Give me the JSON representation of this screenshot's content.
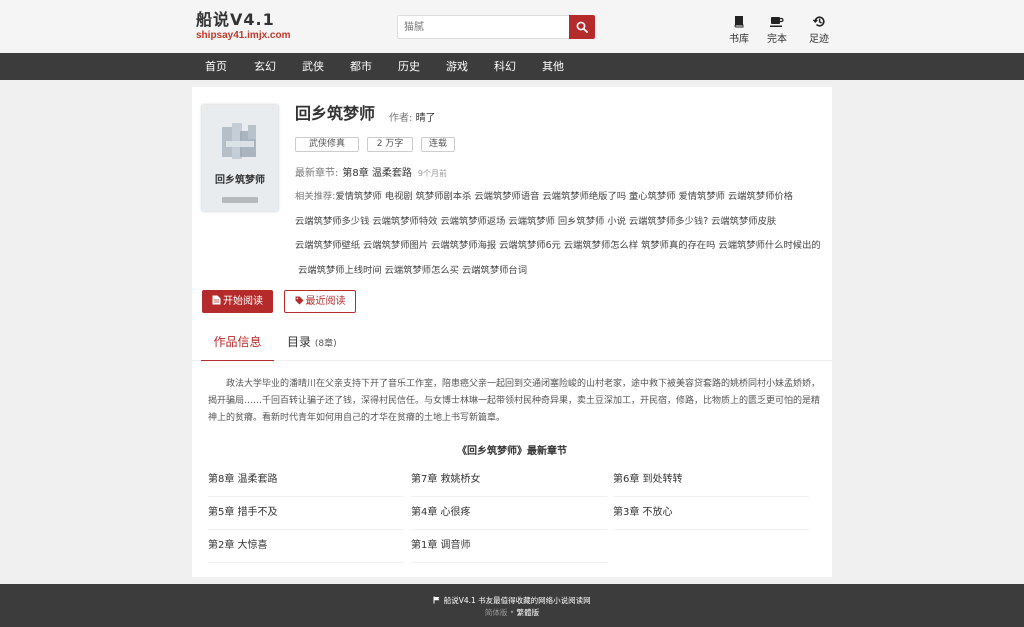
{
  "site": {
    "name": "船说V4.1",
    "domain": "shipsay41.imjx.com"
  },
  "search": {
    "placeholder": "猫腻"
  },
  "top_links": [
    {
      "label": "书库",
      "icon": "book-icon"
    },
    {
      "label": "完本",
      "icon": "coffee-icon"
    },
    {
      "label": "足迹",
      "icon": "history-icon"
    }
  ],
  "nav": [
    "首页",
    "玄幻",
    "武侠",
    "都市",
    "历史",
    "游戏",
    "科幻",
    "其他"
  ],
  "book": {
    "title": "回乡筑梦师",
    "cover_title": "回乡筑梦师",
    "author_label": "作者:",
    "author": "晴了",
    "tags": [
      "武侠修真",
      "2 万字",
      "连载"
    ],
    "latest_label": "最新章节:",
    "latest_chapter": "第8章 温柔套路",
    "latest_time": "9个月前",
    "related_label": "相关推荐:",
    "related_lines": [
      "爱情筑梦师 电视剧 筑梦师剧本杀 云端筑梦师语音 云端筑梦师绝版了吗 童心筑梦师 爱情筑梦师 云端筑梦师价格",
      "云端筑梦师多少钱 云端筑梦师特效 云端筑梦师返场 云端筑梦师 回乡筑梦师 小说 云端筑梦师多少钱? 云端筑梦师皮肤",
      "云端筑梦师壁纸 云端筑梦师图片 云端筑梦师海报 云端筑梦师6元 云端筑梦师怎么样 筑梦师真的存在吗 云端筑梦师什么时候出的",
      "云端筑梦师上线时间 云端筑梦师怎么买 云端筑梦师台词"
    ],
    "start_button": "开始阅读",
    "recent_button": "最近阅读"
  },
  "tabs": {
    "info": "作品信息",
    "toc": "目录",
    "toc_count": "(8章)"
  },
  "intro": "政法大学毕业的潘晴川在父亲支持下开了音乐工作室，陪患癌父亲一起回到交通闭塞险峻的山村老家，途中救下被美容贷套路的姚桥同村小妹孟娇娇，揭开骗局……千回百转让骗子还了钱，深得村民信任。与女博士林琳一起带领村民种奇异果，卖土豆深加工，开民宿，修路，比物质上的匮乏更可怕的是精神上的贫瘠。看新时代青年如何用自己的才华在贫瘠的土地上书写新篇章。",
  "chapters_title": "《回乡筑梦师》最新章节",
  "chapters": [
    "第8章 温柔套路",
    "第7章 救姚桥女",
    "第6章 到处转转",
    "第5章 措手不及",
    "第4章 心很疼",
    "第3章 不放心",
    "第2章 大惊喜",
    "第1章 调音师"
  ],
  "footer": {
    "line1": "船说V4.1 书友最值得收藏的网络小说阅读网",
    "simplified": "简体版",
    "separator": "•",
    "traditional": "繁體版"
  },
  "colors": {
    "accent": "#b52b2b",
    "nav_bg": "#3c3c3c"
  }
}
